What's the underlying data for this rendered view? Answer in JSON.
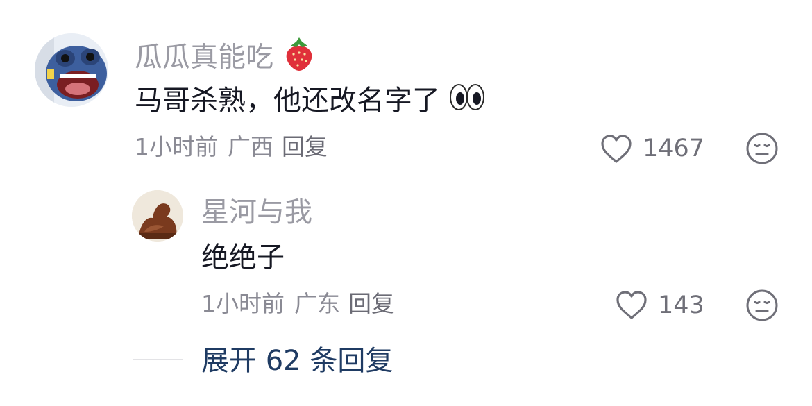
{
  "comments": [
    {
      "username": "瓜瓜真能吃",
      "username_emoji": "strawberry-icon",
      "text": "马哥杀熟，他还改名字了",
      "text_emoji": "eyes-icon",
      "time": "1小时前",
      "location": "广西",
      "reply_label": "回复",
      "likes": "1467",
      "avatar": "cartoon-alien-avatar"
    },
    {
      "username": "星河与我",
      "text": "绝绝子",
      "time": "1小时前",
      "location": "广东",
      "reply_label": "回复",
      "likes": "143",
      "avatar": "carved-statue-avatar"
    }
  ],
  "expand_replies": {
    "label": "展开 62 条回复"
  },
  "colors": {
    "username": "#9a9aa3",
    "body": "#161823",
    "meta": "#8a8a94",
    "expand": "#1f3b63",
    "icon": "#6f6f78"
  }
}
